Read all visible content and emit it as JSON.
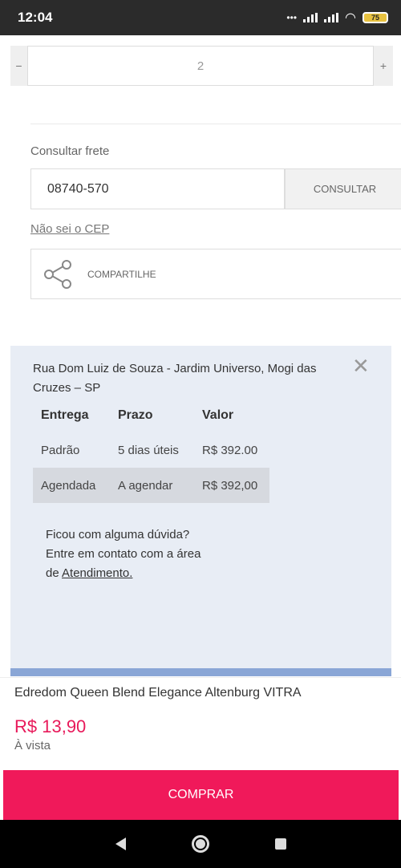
{
  "status_bar": {
    "time": "12:04",
    "battery": "75"
  },
  "quantity": {
    "minus": "−",
    "value": "2",
    "plus": "+"
  },
  "frete": {
    "label": "Consultar frete",
    "cep_value": "08740-570",
    "consult_button": "CONSULTAR",
    "nao_sei_link": "Não sei o CEP"
  },
  "share": {
    "label": "COMPARTILHE"
  },
  "shipping": {
    "address": "Rua Dom Luiz de Souza - Jardim Universo, Mogi das Cruzes – SP",
    "close": "✕",
    "headers": [
      "Entrega",
      "Prazo",
      "Valor"
    ],
    "rows": [
      [
        "Padrão",
        "5 dias úteis",
        "R$ 392.00"
      ],
      [
        "Agendada",
        "A agendar",
        "R$ 392,00"
      ]
    ],
    "help_line1": "Ficou com alguma dúvida?",
    "help_line2": "Entre em contato com a área",
    "help_line3_prefix": "de ",
    "help_link": "Atendimento."
  },
  "product": {
    "name": "Edredom Queen Blend Elegance Altenburg VITRA",
    "price": "R$ 13,90",
    "price_note": "À vista"
  },
  "buy_button": "COMPRAR",
  "colors": {
    "accent": "#f0195a",
    "price": "#e8195a",
    "panel": "#e8edf5"
  }
}
